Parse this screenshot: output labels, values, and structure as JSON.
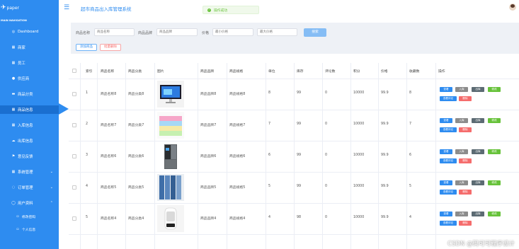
{
  "logo": {
    "text": "paper"
  },
  "nav_title": "MAIN NAVIGATION",
  "menu": [
    {
      "label": "Dashboard",
      "icon": "gauge-icon",
      "glyph": "◎"
    },
    {
      "label": "商家",
      "icon": "grid-icon",
      "glyph": "▦"
    },
    {
      "label": "员工",
      "icon": "grid-icon",
      "glyph": "▦"
    },
    {
      "label": "供应商",
      "icon": "user-icon",
      "glyph": "●"
    },
    {
      "label": "商品分类",
      "icon": "chat-icon",
      "glyph": "▬"
    },
    {
      "label": "商品信息",
      "icon": "grid-icon",
      "glyph": "▦"
    },
    {
      "label": "入库信息",
      "icon": "grid-icon",
      "glyph": "▦"
    },
    {
      "label": "出库信息",
      "icon": "cloud-icon",
      "glyph": "☁"
    },
    {
      "label": "意见反馈",
      "icon": "flag-icon",
      "glyph": "⚑"
    },
    {
      "label": "系统管理",
      "icon": "grid-icon",
      "glyph": "▦"
    },
    {
      "label": "订单管理",
      "icon": "cart-icon",
      "glyph": "◌"
    },
    {
      "label": "用户资料",
      "icon": "user-group-icon",
      "glyph": "◯"
    },
    {
      "label": "修改密码",
      "icon": "key-icon",
      "glyph": "▫"
    },
    {
      "label": "个人信息",
      "icon": "id-icon",
      "glyph": "▫"
    }
  ],
  "header": {
    "title": "超市商品出入库管理系统"
  },
  "toast": {
    "text": "操作成功"
  },
  "filter": {
    "name_label": "商品名称",
    "name_placeholder": "商品名称",
    "brand_label": "商品品牌",
    "brand_placeholder": "商品品牌",
    "price_label": "价格",
    "min_placeholder": "最小价格",
    "max_placeholder": "最大价格",
    "search_btn": "搜索",
    "add_btn": "添加商品",
    "batch_delete_btn": "批量删除"
  },
  "table": {
    "columns": [
      "索引",
      "商品名称",
      "商品分类",
      "图片",
      "商品品牌",
      "商品规格",
      "单位",
      "库存",
      "评论数",
      "积分",
      "价格",
      "收藏数",
      "操作"
    ],
    "rows": [
      {
        "index": "1",
        "name": "商品名称8",
        "category": "商品分类8",
        "image": "monitor-product-image",
        "brand": "商品品牌8",
        "spec": "商品规格8",
        "unit": "8",
        "stock": "99",
        "comments": "0",
        "points": "10000",
        "price": "99.9",
        "favorites": "8"
      },
      {
        "index": "2",
        "name": "商品名称7",
        "category": "商品分类7",
        "image": "towels-product-image",
        "brand": "商品品牌7",
        "spec": "商品规格7",
        "unit": "7",
        "stock": "99",
        "comments": "0",
        "points": "10000",
        "price": "99.9",
        "favorites": "7"
      },
      {
        "index": "3",
        "name": "商品名称6",
        "category": "商品分类6",
        "image": "fridge-product-image",
        "brand": "商品品牌6",
        "spec": "商品规格6",
        "unit": "6",
        "stock": "99",
        "comments": "0",
        "points": "10000",
        "price": "99.9",
        "favorites": "6"
      },
      {
        "index": "4",
        "name": "商品名称5",
        "category": "商品分类5",
        "image": "jeans-product-image",
        "brand": "商品品牌5",
        "spec": "商品规格5",
        "unit": "5",
        "stock": "99",
        "comments": "0",
        "points": "10000",
        "price": "99.9",
        "favorites": "5"
      },
      {
        "index": "5",
        "name": "商品名称4",
        "category": "商品分类4",
        "image": "heater-product-image",
        "brand": "商品品牌4",
        "spec": "商品规格4",
        "unit": "4",
        "stock": "98",
        "comments": "0",
        "points": "10000",
        "price": "99.9",
        "favorites": "4"
      }
    ],
    "actions": {
      "view": "查看",
      "in": "入库",
      "out": "出库",
      "edit": "修改",
      "comments": "查看评论",
      "delete": "删除"
    }
  },
  "watermark": "CSDN @码可可程序设计",
  "colors": {
    "sidebar": "#2e8cf0",
    "active": "#1a6fd0",
    "success": "#67c23a",
    "danger": "#f56c6c"
  }
}
